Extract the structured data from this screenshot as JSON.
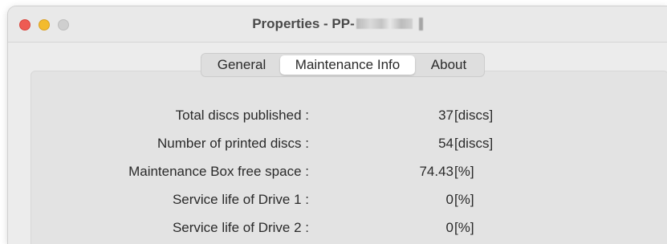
{
  "window": {
    "title_prefix": "Properties - PP-"
  },
  "tabs": [
    {
      "label": "General",
      "selected": false
    },
    {
      "label": "Maintenance Info",
      "selected": true
    },
    {
      "label": "About",
      "selected": false
    }
  ],
  "rows": [
    {
      "label": "Total discs published :",
      "value": "37",
      "unit": "[discs]"
    },
    {
      "label": "Number of printed discs :",
      "value": "54",
      "unit": "[discs]"
    },
    {
      "label": "Maintenance Box free space :",
      "value": "74.43",
      "unit": "[%]"
    },
    {
      "label": "Service life of Drive 1 :",
      "value": "0",
      "unit": "[%]"
    },
    {
      "label": "Service life of Drive 2 :",
      "value": "0",
      "unit": "[%]"
    }
  ],
  "colors": {
    "close": "#ee5b53",
    "minimize": "#f3bb2e",
    "zoom": "#cfcfcf",
    "window_bg": "#ececec",
    "selected_tab_bg": "#ffffff"
  }
}
